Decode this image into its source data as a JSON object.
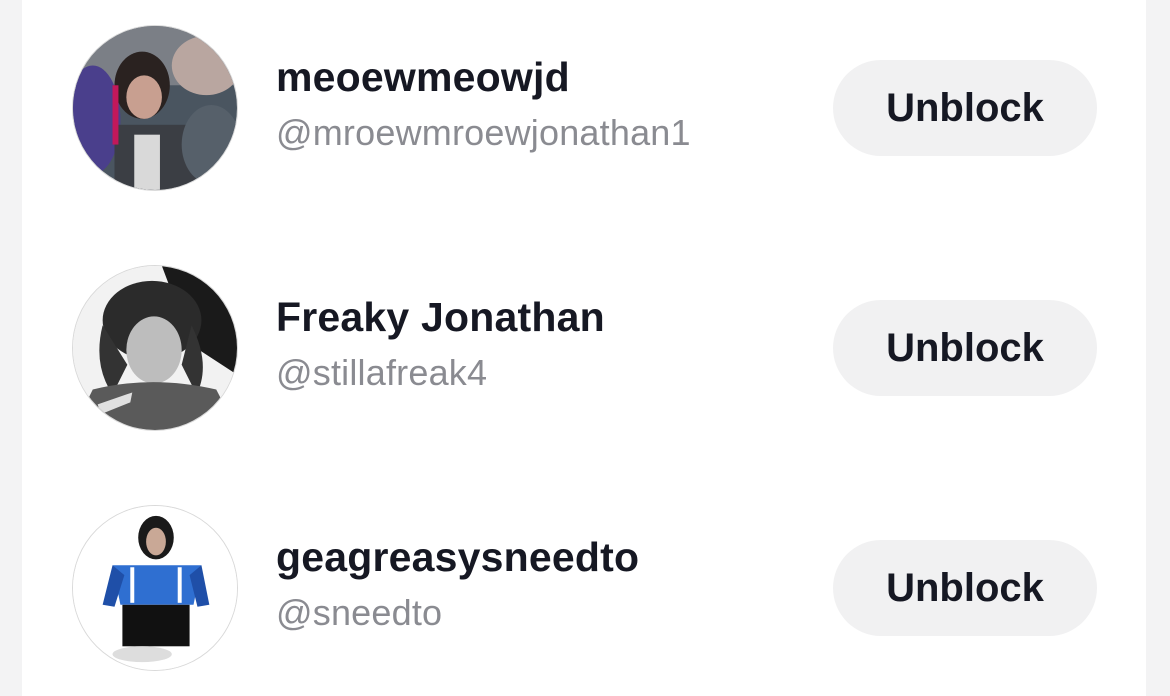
{
  "blocked_accounts": [
    {
      "display_name": "meoewmeowjd",
      "username": "@mroewmroewjonathan1",
      "avatar_icon": "avatar-photo-icon",
      "button_label": "Unblock"
    },
    {
      "display_name": "Freaky Jonathan",
      "username": "@stillafreak4",
      "avatar_icon": "avatar-photo-icon",
      "button_label": "Unblock"
    },
    {
      "display_name": "geagreasysneedto",
      "username": "@sneedto",
      "avatar_icon": "avatar-photo-icon",
      "button_label": "Unblock"
    }
  ],
  "colors": {
    "background": "#f3f3f4",
    "panel": "#ffffff",
    "name_text": "#161823",
    "handle_text": "#8a8b91",
    "button_bg": "#f1f1f2"
  }
}
